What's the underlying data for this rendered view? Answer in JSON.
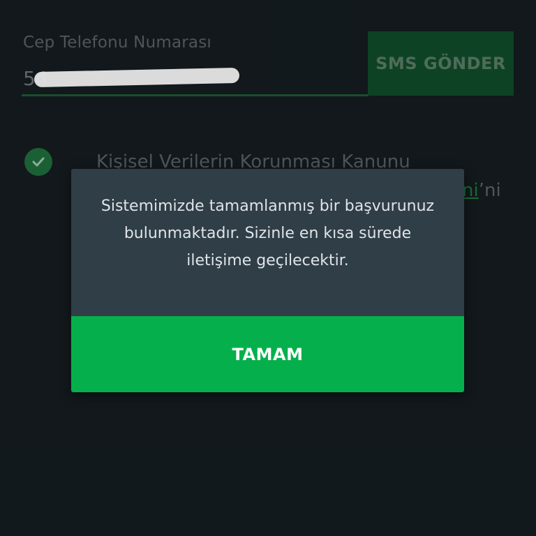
{
  "phone": {
    "label": "Cep Telefonu Numarası",
    "value": "54"
  },
  "sms_button": {
    "label": "SMS GÖNDER"
  },
  "consent": {
    "text": "Kişisel Verilerin Korunması Kanunu",
    "link_fragment": "ni",
    "suffix": "’ni"
  },
  "dialog": {
    "message_lines": [
      "Sistemimizde tamamlanmış bir başvurunuz",
      "bulunmaktadır. Sizinle en kısa sürede",
      "iletişime geçilecektir."
    ],
    "ok_label": "TAMAM"
  },
  "colors": {
    "background": "#151c20",
    "accent_green": "#05b04c",
    "dialog_bg": "#2f3e47",
    "sms_button_bg": "#0f4d2a"
  },
  "icons": {
    "consent_check": "check-circle-icon"
  }
}
